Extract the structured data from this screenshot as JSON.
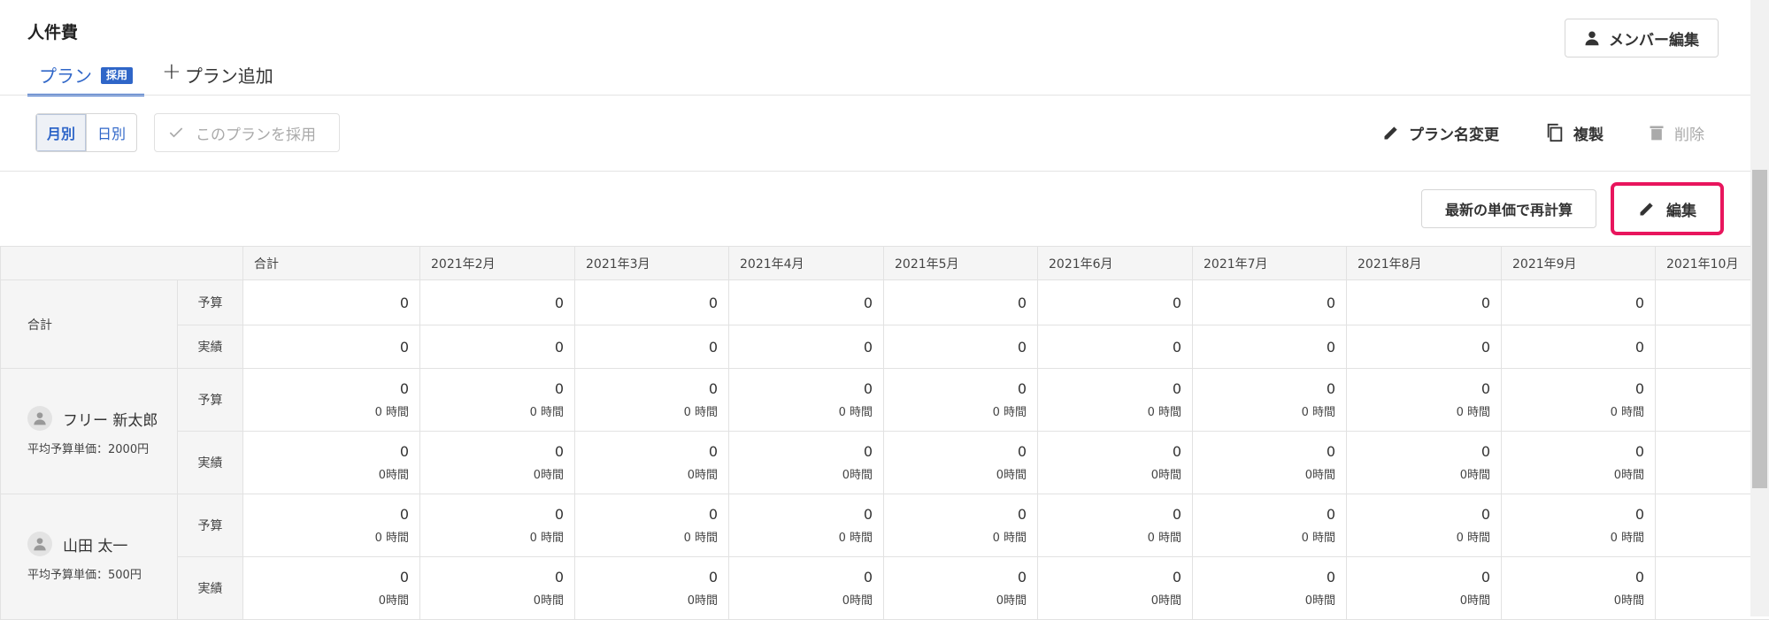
{
  "page": {
    "title": "人件費",
    "member_edit_label": "メンバー編集"
  },
  "tabs": {
    "plan_label": "プラン",
    "plan_badge": "採用",
    "add_label": "プラン追加"
  },
  "toolbar": {
    "monthly_label": "月別",
    "daily_label": "日別",
    "adopt_label": "このプランを採用",
    "rename_label": "プラン名変更",
    "duplicate_label": "複製",
    "delete_label": "削除",
    "recalc_label": "最新の単価で再計算",
    "edit_label": "編集"
  },
  "table": {
    "headers": [
      "合計",
      "2021年2月",
      "2021年3月",
      "2021年4月",
      "2021年5月",
      "2021年6月",
      "2021年7月",
      "2021年8月",
      "2021年9月",
      "2021年10月"
    ],
    "budget_label": "予算",
    "actual_label": "実績",
    "total_row_label": "合計",
    "total_budget": [
      "0",
      "0",
      "0",
      "0",
      "0",
      "0",
      "0",
      "0",
      "0",
      ""
    ],
    "total_actual": [
      "0",
      "0",
      "0",
      "0",
      "0",
      "0",
      "0",
      "0",
      "0",
      ""
    ],
    "members": [
      {
        "name": "フリー 新太郎",
        "avg_price": "平均予算単価：2000円",
        "budget": [
          "0",
          "0",
          "0",
          "0",
          "0",
          "0",
          "0",
          "0",
          "0",
          ""
        ],
        "budget_hours": [
          "0 時間",
          "0 時間",
          "0 時間",
          "0 時間",
          "0 時間",
          "0 時間",
          "0 時間",
          "0 時間",
          "0 時間",
          ""
        ],
        "actual": [
          "0",
          "0",
          "0",
          "0",
          "0",
          "0",
          "0",
          "0",
          "0",
          ""
        ],
        "actual_hours": [
          "0時間",
          "0時間",
          "0時間",
          "0時間",
          "0時間",
          "0時間",
          "0時間",
          "0時間",
          "0時間",
          ""
        ]
      },
      {
        "name": "山田 太一",
        "avg_price": "平均予算単価：500円",
        "budget": [
          "0",
          "0",
          "0",
          "0",
          "0",
          "0",
          "0",
          "0",
          "0",
          ""
        ],
        "budget_hours": [
          "0 時間",
          "0 時間",
          "0 時間",
          "0 時間",
          "0 時間",
          "0 時間",
          "0 時間",
          "0 時間",
          "0 時間",
          ""
        ],
        "actual": [
          "0",
          "0",
          "0",
          "0",
          "0",
          "0",
          "0",
          "0",
          "0",
          ""
        ],
        "actual_hours": [
          "0時間",
          "0時間",
          "0時間",
          "0時間",
          "0時間",
          "0時間",
          "0時間",
          "0時間",
          "0時間",
          ""
        ]
      }
    ]
  }
}
